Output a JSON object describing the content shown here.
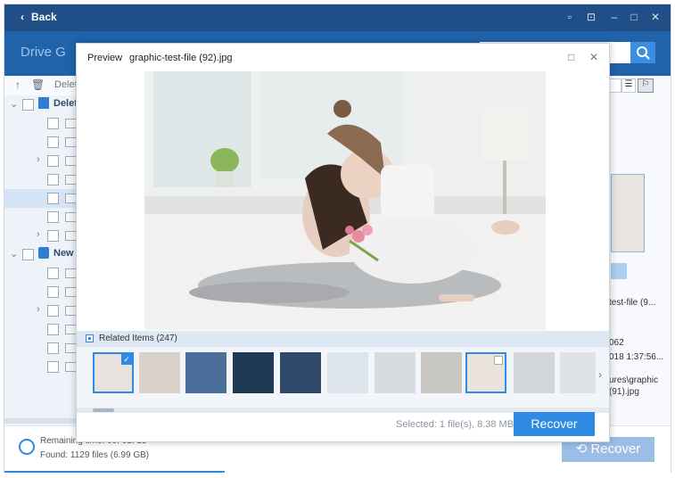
{
  "window": {
    "back_label": "Back",
    "drive_title": "Drive G"
  },
  "toolbar": {
    "breadcrumb": "Delet"
  },
  "tree": {
    "deleted_label": "Delet",
    "new_label": "New"
  },
  "right_pane": {
    "file_name_line1": "test-file (9...",
    "date_line1": "062",
    "date_line2": "018 1:37:56...",
    "path_line1": "ures\\graphic",
    "path_line2": "(91).jpg"
  },
  "status": {
    "remaining": "Remaining time: 00: 01: 15",
    "found": "Found: 1129 files (6.99 GB)",
    "recover_label": "Recover"
  },
  "preview": {
    "title": "Preview",
    "file_name": "graphic-test-file (92).jpg",
    "related_label": "Related Items (247)",
    "selected_text": "Selected: 1 file(s), 8.38 MB",
    "recover_label": "Recover"
  },
  "colors": {
    "accent": "#2e8ae4",
    "header": "#2063aa",
    "titlebar": "#1f4f86"
  }
}
